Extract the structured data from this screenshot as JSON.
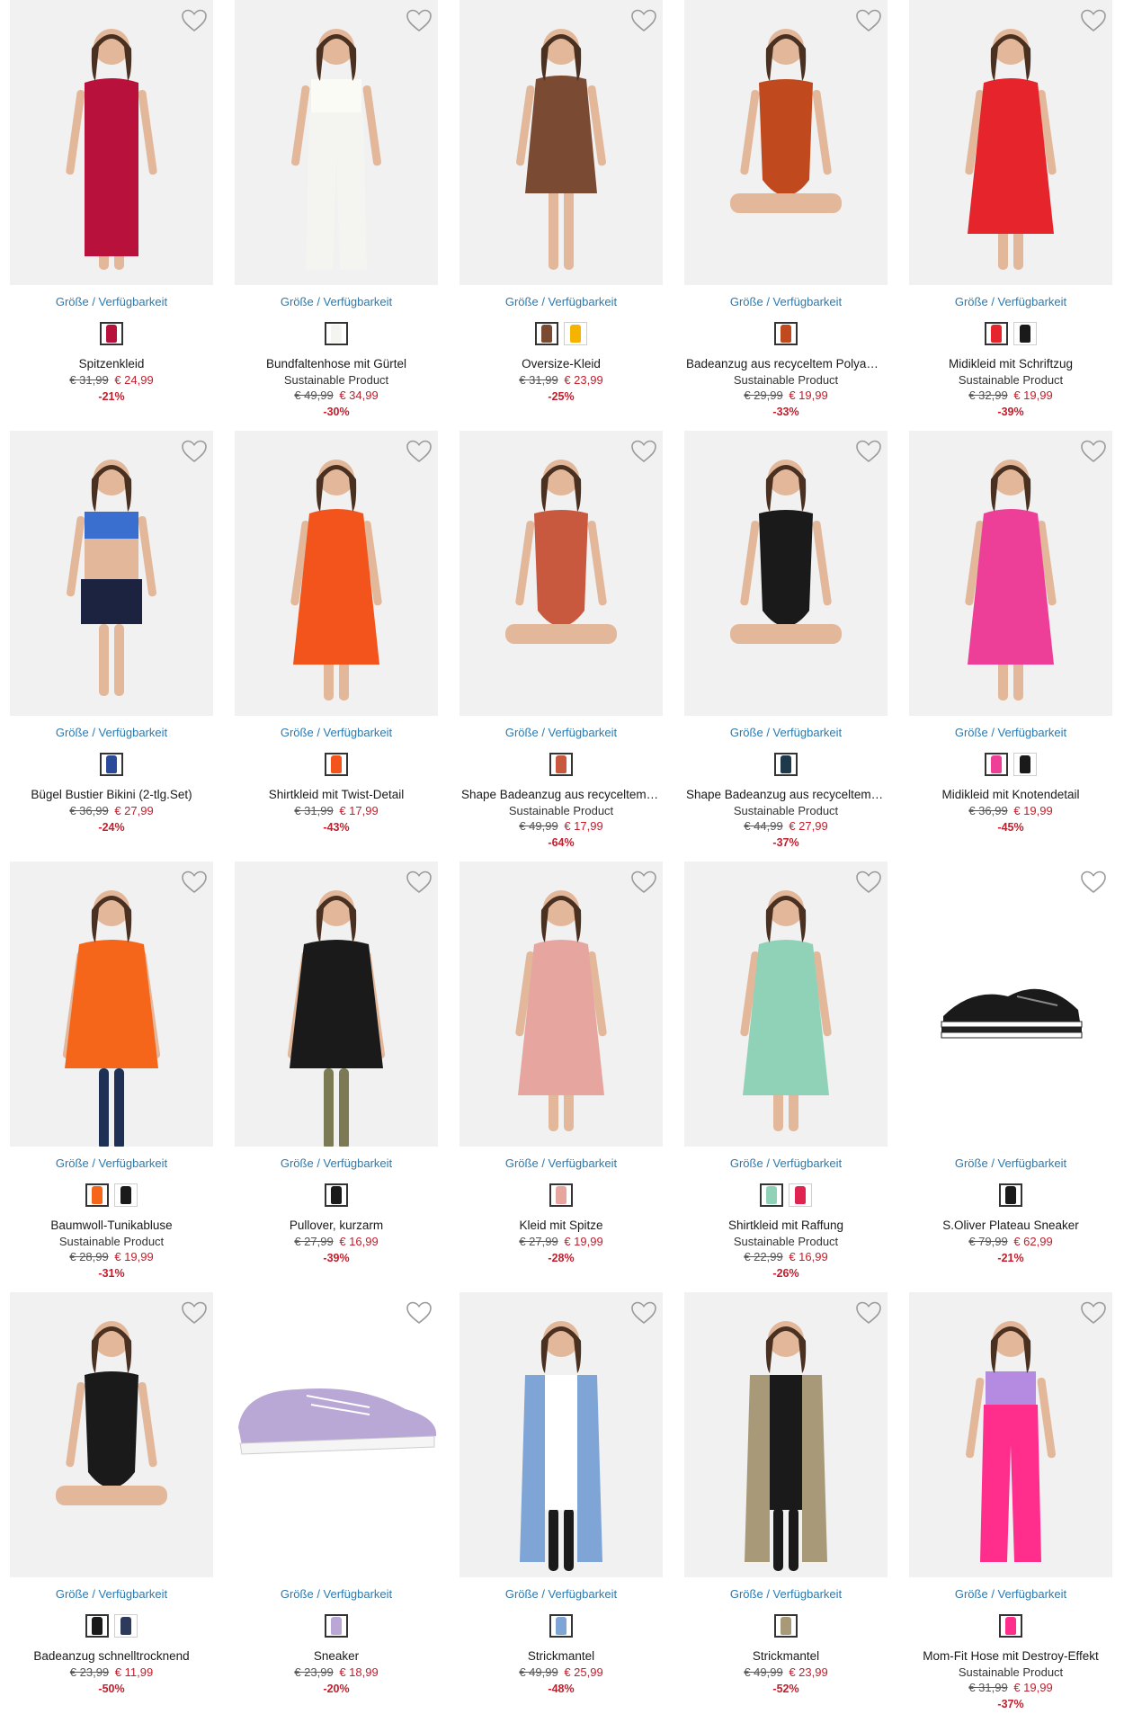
{
  "labels": {
    "sizes_link": "Größe / Verfügbarkeit"
  },
  "colors": {
    "link": "#2a7ab0",
    "price_new": "#c41d2b",
    "discount": "#c41d2b",
    "image_bg": "#f1f1f1"
  },
  "products": [
    {
      "title": "Spitzenkleid",
      "sub": "",
      "old_price": "€ 31,99",
      "new_price": "€ 24,99",
      "discount": "-21%",
      "image": "model-in-red-lace-dress",
      "garment_color": "#b8123c",
      "swatches": [
        "#b8123c"
      ]
    },
    {
      "title": "Bundfaltenhose mit Gürtel",
      "sub": "Sustainable Product",
      "old_price": "€ 49,99",
      "new_price": "€ 34,99",
      "discount": "-30%",
      "image": "model-in-white-trousers",
      "garment_color": "#f4f4f0",
      "swatches": [
        "#f4f4f0"
      ]
    },
    {
      "title": "Oversize-Kleid",
      "sub": "",
      "old_price": "€ 31,99",
      "new_price": "€ 23,99",
      "discount": "-25%",
      "image": "model-in-brown-dress",
      "garment_color": "#7a4a32",
      "swatches": [
        "#7a4a32",
        "#f5b400"
      ]
    },
    {
      "title": "Badeanzug aus recyceltem Polyamid",
      "sub": "Sustainable Product",
      "old_price": "€ 29,99",
      "new_price": "€ 19,99",
      "discount": "-33%",
      "image": "model-in-rust-swimsuit",
      "garment_color": "#c04a1e",
      "swatches": [
        "#c04a1e"
      ]
    },
    {
      "title": "Midikleid mit Schriftzug",
      "sub": "Sustainable Product",
      "old_price": "€ 32,99",
      "new_price": "€ 19,99",
      "discount": "-39%",
      "image": "model-in-red-midi-dress",
      "garment_color": "#e5252b",
      "swatches": [
        "#e5252b",
        "#1a1a1a"
      ]
    },
    {
      "title": "Bügel Bustier Bikini (2-tlg.Set)",
      "sub": "",
      "old_price": "€ 36,99",
      "new_price": "€ 27,99",
      "discount": "-24%",
      "image": "model-in-bikini",
      "garment_color": "#1c2340",
      "swatches": [
        "#2b4a9a"
      ]
    },
    {
      "title": "Shirtkleid mit Twist-Detail",
      "sub": "",
      "old_price": "€ 31,99",
      "new_price": "€ 17,99",
      "discount": "-43%",
      "image": "model-in-orange-dress",
      "garment_color": "#f2541b",
      "swatches": [
        "#f2541b"
      ]
    },
    {
      "title": "Shape Badeanzug aus recyceltem P...",
      "sub": "Sustainable Product",
      "old_price": "€ 49,99",
      "new_price": "€ 17,99",
      "discount": "-64%",
      "image": "model-in-terracotta-swimsuit",
      "garment_color": "#c9593e",
      "swatches": [
        "#c9593e"
      ]
    },
    {
      "title": "Shape Badeanzug aus recyceltem P...",
      "sub": "Sustainable Product",
      "old_price": "€ 44,99",
      "new_price": "€ 27,99",
      "discount": "-37%",
      "image": "model-in-black-swimsuit",
      "garment_color": "#1a1a1a",
      "swatches": [
        "#1e3a4a"
      ]
    },
    {
      "title": "Midikleid mit Knotendetail",
      "sub": "",
      "old_price": "€ 36,99",
      "new_price": "€ 19,99",
      "discount": "-45%",
      "image": "model-in-pink-shirtdress",
      "garment_color": "#ee3f98",
      "swatches": [
        "#ee3f98",
        "#1a1a1a"
      ]
    },
    {
      "title": "Baumwoll-Tunikabluse",
      "sub": "Sustainable Product",
      "old_price": "€ 28,99",
      "new_price": "€ 19,99",
      "discount": "-31%",
      "image": "model-in-orange-blouse",
      "garment_color": "#f5661b",
      "swatches": [
        "#f5661b",
        "#1a1a1a"
      ]
    },
    {
      "title": "Pullover, kurzarm",
      "sub": "",
      "old_price": "€ 27,99",
      "new_price": "€ 16,99",
      "discount": "-39%",
      "image": "model-in-floral-top",
      "garment_color": "#1a1a1a",
      "swatches": [
        "#1a1a1a"
      ]
    },
    {
      "title": "Kleid mit Spitze",
      "sub": "",
      "old_price": "€ 27,99",
      "new_price": "€ 19,99",
      "discount": "-28%",
      "image": "model-in-rose-dress",
      "garment_color": "#e7a5a0",
      "swatches": [
        "#e7a5a0"
      ]
    },
    {
      "title": "Shirtkleid mit Raffung",
      "sub": "Sustainable Product",
      "old_price": "€ 22,99",
      "new_price": "€ 16,99",
      "discount": "-26%",
      "image": "model-in-mint-dress",
      "garment_color": "#8fd2b8",
      "swatches": [
        "#8fd2b8",
        "#e02452"
      ]
    },
    {
      "title": "S.Oliver Plateau Sneaker",
      "sub": "",
      "old_price": "€ 79,99",
      "new_price": "€ 62,99",
      "discount": "-21%",
      "image": "black-platform-sneaker",
      "garment_color": "#1a1a1a",
      "swatches": [
        "#1a1a1a"
      ]
    },
    {
      "title": "Badeanzug schnelltrocknend",
      "sub": "",
      "old_price": "€ 23,99",
      "new_price": "€ 11,99",
      "discount": "-50%",
      "image": "model-in-black-swimsuit-hat",
      "garment_color": "#1a1a1a",
      "swatches": [
        "#1a1a1a",
        "#2d3a5c"
      ]
    },
    {
      "title": "Sneaker",
      "sub": "",
      "old_price": "€ 23,99",
      "new_price": "€ 18,99",
      "discount": "-20%",
      "image": "lilac-lace-sneaker",
      "garment_color": "#b9a8d6",
      "swatches": [
        "#b9a8d6"
      ]
    },
    {
      "title": "Strickmantel",
      "sub": "",
      "old_price": "€ 49,99",
      "new_price": "€ 25,99",
      "discount": "-48%",
      "image": "model-in-blue-cardigan",
      "garment_color": "#7fa4d6",
      "swatches": [
        "#7fa4d6"
      ]
    },
    {
      "title": "Strickmantel",
      "sub": "",
      "old_price": "€ 49,99",
      "new_price": "€ 23,99",
      "discount": "-52%",
      "image": "model-in-beige-long-cardigan",
      "garment_color": "#a89a78",
      "swatches": [
        "#a89a78"
      ]
    },
    {
      "title": "Mom-Fit Hose mit Destroy-Effekt",
      "sub": "Sustainable Product",
      "old_price": "€ 31,99",
      "new_price": "€ 19,99",
      "discount": "-37%",
      "image": "model-in-pink-jeans",
      "garment_color": "#ff2e8c",
      "swatches": [
        "#ff2e8c"
      ]
    }
  ]
}
